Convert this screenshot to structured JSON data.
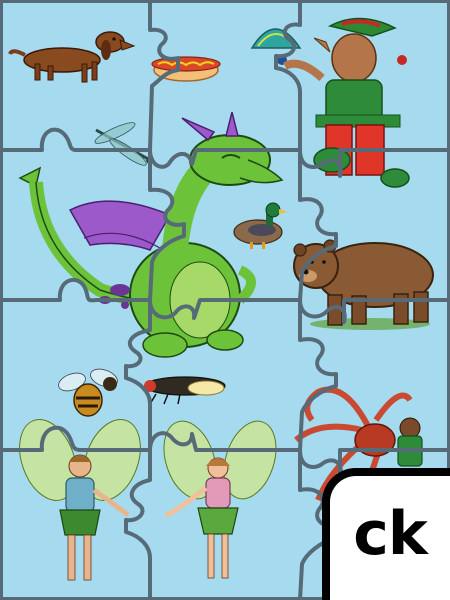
{
  "puzzle": {
    "rows": 4,
    "cols": 3,
    "colors": {
      "background": "#a6daee",
      "piece_edge": "#566a78",
      "badge_bg": "#ffffff",
      "badge_border": "#000000"
    },
    "pictures": [
      {
        "name": "dachshund-dog"
      },
      {
        "name": "hot-dog"
      },
      {
        "name": "elf-with-peacock"
      },
      {
        "name": "dragonfly"
      },
      {
        "name": "green-dragon"
      },
      {
        "name": "duck"
      },
      {
        "name": "brown-bear"
      },
      {
        "name": "bee"
      },
      {
        "name": "firefly"
      },
      {
        "name": "octopus-with-boy"
      },
      {
        "name": "male-fairy"
      },
      {
        "name": "female-fairy"
      }
    ]
  },
  "badge": {
    "text": "ck"
  }
}
